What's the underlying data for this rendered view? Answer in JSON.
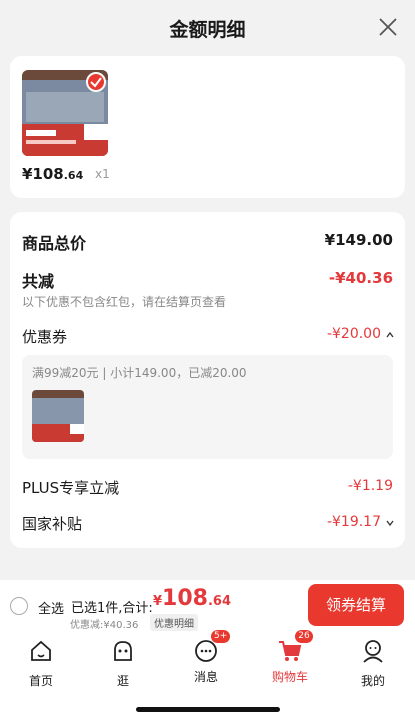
{
  "header": {
    "title": "金额明细"
  },
  "product": {
    "price_int": "¥108",
    "price_dec": ".64",
    "qty": "x1"
  },
  "summary": {
    "total_label": "商品总价",
    "total_value": "¥149.00",
    "reduce_label": "共减",
    "reduce_value": "-¥40.36",
    "hint": "以下优惠不包含红包，请在结算页查看",
    "coupon_label": "优惠券",
    "coupon_value": "-¥20.00",
    "coupon_desc": "满99减20元 | 小计149.00，已减20.00",
    "plus_label": "PLUS专享立减",
    "plus_value": "-¥1.19",
    "subsidy_label": "国家补贴",
    "subsidy_value": "-¥19.17"
  },
  "bottom": {
    "select_all": "全选",
    "selected_text": "已选1件,合计:",
    "total_cur": "¥",
    "total_int": "108",
    "total_dec": ".64",
    "discount_text": "优惠减:¥40.36",
    "detail_btn": "优惠明细",
    "checkout": "领券结算"
  },
  "tabs": [
    {
      "label": "首页"
    },
    {
      "label": "逛"
    },
    {
      "label": "消息",
      "badge": "5+"
    },
    {
      "label": "购物车",
      "badge": "26"
    },
    {
      "label": "我的"
    }
  ],
  "colors": {
    "accent": "#e4393c",
    "checkout_bg": "#e9392f"
  }
}
